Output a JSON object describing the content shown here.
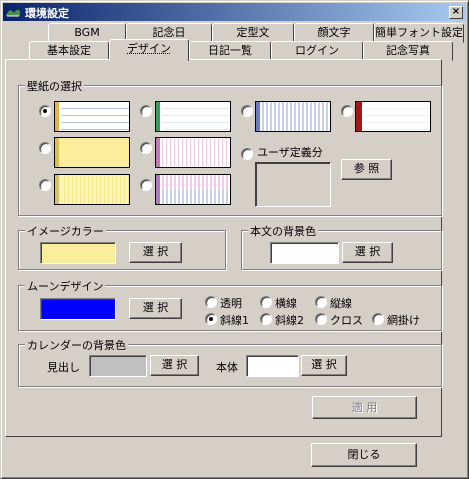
{
  "window": {
    "title": "環境設定",
    "close": "×"
  },
  "tabs_back": [
    "BGM",
    "記念日",
    "定型文",
    "顔文字",
    "簡単フォント設定"
  ],
  "tabs_front": [
    "基本設定",
    "デザイン",
    "日記一覧",
    "ログイン",
    "記念写真"
  ],
  "active_tab": "デザイン",
  "wallpaper": {
    "label": "壁紙の選択",
    "user_defined_label": "ユーザ定義分",
    "browse_label": "参 照",
    "selected_index": 0
  },
  "image_color": {
    "label": "イメージカラー",
    "button": "選 択",
    "color": "#fbee9b"
  },
  "body_bg": {
    "label": "本文の背景色",
    "button": "選 択",
    "color": "#ffffff"
  },
  "moon_design": {
    "label": "ムーンデザイン",
    "button": "選 択",
    "color": "#0000ff",
    "options_row1": [
      "透明",
      "横線",
      "縦線"
    ],
    "options_row2": [
      "斜線1",
      "斜線2",
      "クロス",
      "網掛け"
    ],
    "selected": "斜線1"
  },
  "calendar_bg": {
    "label": "カレンダーの背景色",
    "heading_label": "見出し",
    "heading_color": "#c0c0c0",
    "body_label": "本体",
    "body_color": "#ffffff",
    "button": "選 択"
  },
  "apply_button": "適 用",
  "close_button": "閉じる"
}
